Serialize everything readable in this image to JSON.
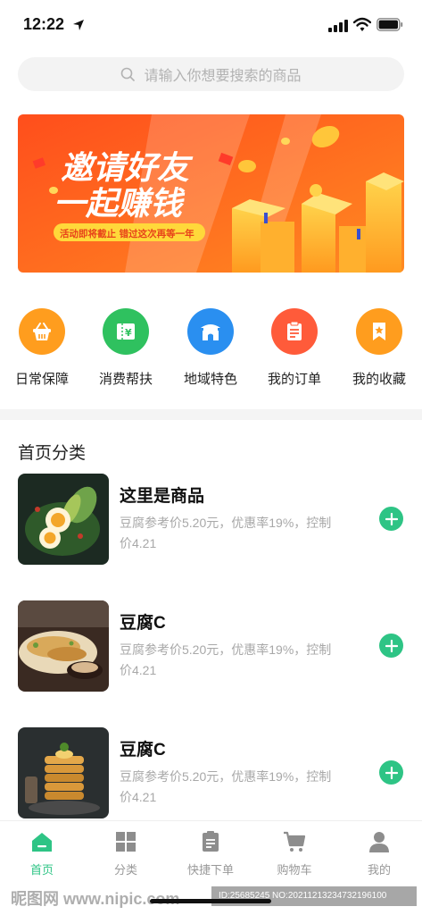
{
  "status_bar": {
    "time": "12:22"
  },
  "search": {
    "placeholder": "请输入你想要搜索的商品"
  },
  "banner": {
    "title_line1": "邀请好友",
    "title_line2": "一起赚钱",
    "subtitle": "活动即将截止  错过这次再等一年"
  },
  "categories": [
    {
      "label": "日常保障",
      "icon": "basket-icon",
      "color": "#ff9d1e"
    },
    {
      "label": "消费帮扶",
      "icon": "ticket-icon",
      "color": "#2fc15f"
    },
    {
      "label": "地域特色",
      "icon": "pavilion-icon",
      "color": "#2a8ff0"
    },
    {
      "label": "我的订单",
      "icon": "clipboard-icon",
      "color": "#ff5b3a"
    },
    {
      "label": "我的收藏",
      "icon": "bookmark-star-icon",
      "color": "#ff9d1e"
    }
  ],
  "section_title": "首页分类",
  "products": [
    {
      "name": "这里是商品",
      "desc": "豆腐参考价5.20元，优惠率19%，控制价4.21"
    },
    {
      "name": "豆腐C",
      "desc": "豆腐参考价5.20元，优惠率19%，控制价4.21"
    },
    {
      "name": "豆腐C",
      "desc": "豆腐参考价5.20元，优惠率19%，控制价4.21"
    }
  ],
  "tabbar": [
    {
      "label": "首页",
      "icon": "home-icon",
      "active": true
    },
    {
      "label": "分类",
      "icon": "grid-icon",
      "active": false
    },
    {
      "label": "快捷下单",
      "icon": "order-icon",
      "active": false
    },
    {
      "label": "购物车",
      "icon": "cart-icon",
      "active": false
    },
    {
      "label": "我的",
      "icon": "user-icon",
      "active": false
    }
  ],
  "watermark": {
    "left": "昵图网 www.nipic.com",
    "right": "ID:25685245 NO:20211213234732196100"
  },
  "colors": {
    "accent": "#2ec485",
    "banner_orange": "#ff6a1a"
  }
}
